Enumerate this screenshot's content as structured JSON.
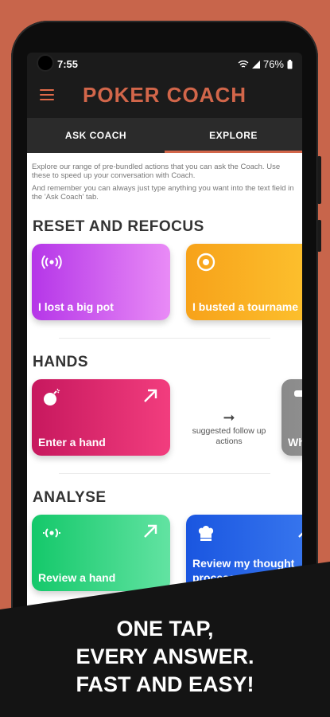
{
  "status": {
    "time": "7:55",
    "battery": "76%"
  },
  "app": {
    "title": "POKER COACH"
  },
  "tabs": [
    {
      "label": "ASK COACH"
    },
    {
      "label": "EXPLORE"
    }
  ],
  "intro": {
    "line1": "Explore our range of pre-bundled actions that you can ask the Coach. Use these to speed up your conversation with Coach.",
    "line2": "And remember you can always just type anything you want into the text field in the 'Ask Coach' tab."
  },
  "sections": {
    "reset": {
      "title": "RESET AND REFOCUS",
      "cards": [
        {
          "label": "I lost a big pot",
          "icon": "broadcast-icon",
          "color_from": "#b536e8",
          "color_to": "#e98bf6"
        },
        {
          "label": "I busted a tourname",
          "icon": "target-icon",
          "color_from": "#f7a21a",
          "color_to": "#fdc430"
        }
      ]
    },
    "hands": {
      "title": "HANDS",
      "cards": [
        {
          "label": "Enter a hand",
          "icon": "bomb-icon",
          "color_from": "#c7185e",
          "color_to": "#f23d7e"
        },
        {
          "label": "Wh str",
          "icon": "partial-icon",
          "color_from": "#8a8a8a",
          "color_to": "#a5a5a5"
        }
      ],
      "suggested": "suggested follow up actions"
    },
    "analyse": {
      "title": "ANALYSE",
      "cards": [
        {
          "label": "Review a hand",
          "icon": "signal-icon",
          "color_from": "#14c86a",
          "color_to": "#62e3a2"
        },
        {
          "label": "Review my thought process",
          "icon": "chef-hat-icon",
          "color_from": "#1a56e0",
          "color_to": "#3b7af0"
        }
      ]
    }
  },
  "banner": {
    "line1": "ONE TAP,",
    "line2": "EVERY ANSWER.",
    "line3": "FAST AND EASY!"
  }
}
